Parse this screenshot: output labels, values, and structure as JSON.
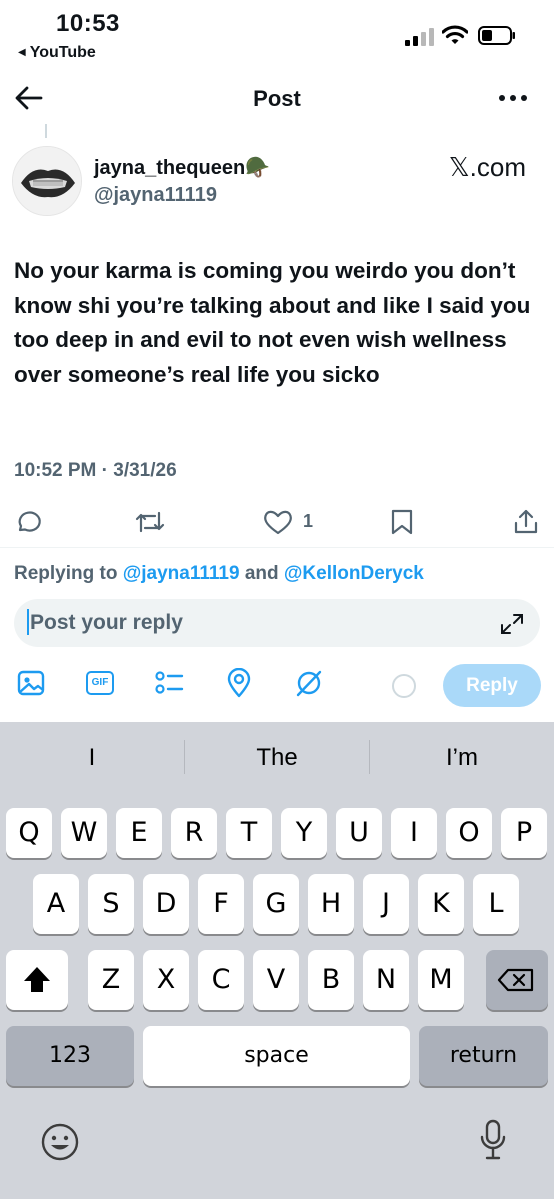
{
  "status_bar": {
    "time": "10:53",
    "back_app": "YouTube"
  },
  "nav": {
    "title": "Post"
  },
  "author": {
    "display_name": "jayna_thequeen🪖",
    "handle": "@jayna11119",
    "source": "𝕏.com"
  },
  "post": {
    "text": "No your karma is coming you weirdo you don’t know shi you’re talking about and like I said you too deep in and evil to not even wish wellness over someone’s real life you sicko",
    "timestamp": "10:52 PM · 3/31/26",
    "like_count": "1"
  },
  "reply": {
    "replying_prefix": "Replying to",
    "mention1": "@jayna11119",
    "and": "and",
    "mention2": "@KellonDeryck",
    "placeholder": "Post your reply",
    "button_label": "Reply",
    "gif_label": "GIF"
  },
  "keyboard": {
    "suggestions": [
      "I",
      "The",
      "I’m"
    ],
    "row1": [
      "Q",
      "W",
      "E",
      "R",
      "T",
      "Y",
      "U",
      "I",
      "O",
      "P"
    ],
    "row2": [
      "A",
      "S",
      "D",
      "F",
      "G",
      "H",
      "J",
      "K",
      "L"
    ],
    "row3": [
      "Z",
      "X",
      "C",
      "V",
      "B",
      "N",
      "M"
    ],
    "numbers_label": "123",
    "space_label": "space",
    "return_label": "return"
  },
  "colors": {
    "accent": "#1d9bf0",
    "secondary_text": "#536471",
    "keyboard_bg": "#d1d4da"
  }
}
